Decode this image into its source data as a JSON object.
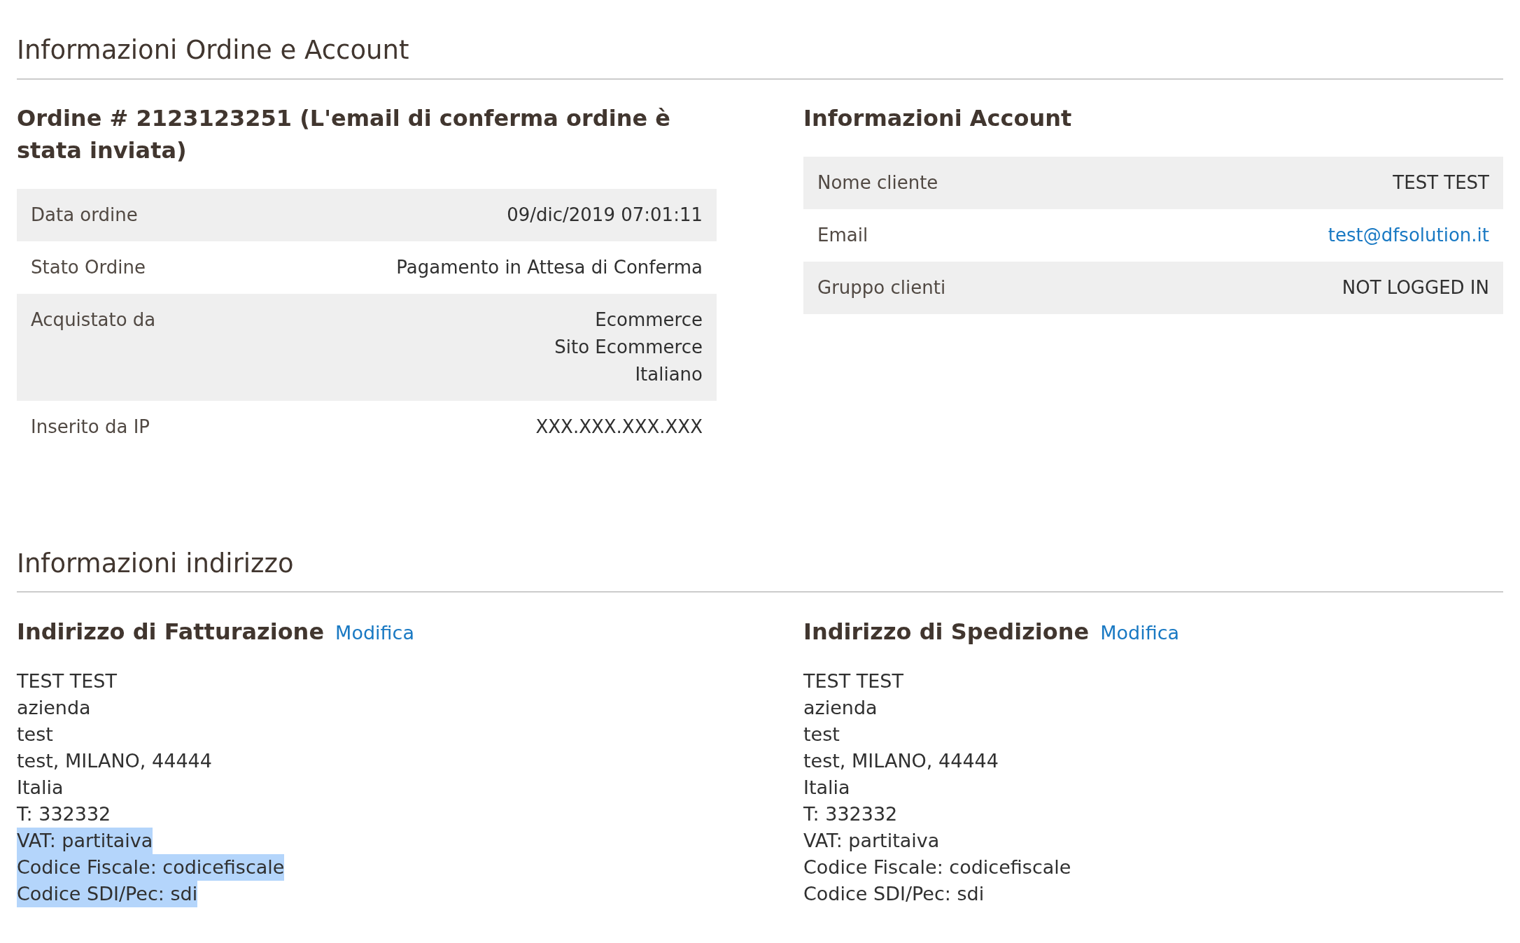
{
  "order_account": {
    "title": "Informazioni Ordine e Account",
    "order": {
      "heading": "Ordine # 2123123251 (L'email di conferma ordine è stata inviata)",
      "rows": [
        {
          "label": "Data ordine",
          "kind": "text",
          "lines": [
            "09/dic/2019 07:01:11"
          ]
        },
        {
          "label": "Stato Ordine",
          "kind": "text",
          "lines": [
            "Pagamento in Attesa di Conferma"
          ]
        },
        {
          "label": "Acquistato da",
          "kind": "text",
          "lines": [
            "Ecommerce",
            "Sito Ecommerce",
            "Italiano"
          ]
        },
        {
          "label": "Inserito da IP",
          "kind": "text",
          "lines": [
            "XXX.XXX.XXX.XXX"
          ]
        }
      ]
    },
    "account": {
      "heading": "Informazioni Account",
      "rows": [
        {
          "label": "Nome cliente",
          "kind": "text",
          "lines": [
            "TEST TEST"
          ]
        },
        {
          "label": "Email",
          "kind": "link",
          "lines": [
            "test@dfsolution.it"
          ]
        },
        {
          "label": "Gruppo clienti",
          "kind": "text",
          "lines": [
            "NOT LOGGED IN"
          ]
        }
      ]
    }
  },
  "address": {
    "title": "Informazioni indirizzo",
    "billing": {
      "heading": "Indirizzo di Fatturazione",
      "edit_link": "Modifica",
      "lines": [
        {
          "text": "TEST TEST",
          "highlighted": false
        },
        {
          "text": "azienda",
          "highlighted": false
        },
        {
          "text": "test",
          "highlighted": false
        },
        {
          "text": "test, MILANO, 44444",
          "highlighted": false
        },
        {
          "text": "Italia",
          "highlighted": false
        },
        {
          "text": "T: 332332",
          "highlighted": false
        },
        {
          "text": "VAT: partitaiva",
          "highlighted": true
        },
        {
          "text": "Codice Fiscale: codicefiscale",
          "highlighted": true
        },
        {
          "text": "Codice SDI/Pec: sdi",
          "highlighted": true
        }
      ]
    },
    "shipping": {
      "heading": "Indirizzo di Spedizione",
      "edit_link": "Modifica",
      "lines": [
        {
          "text": "TEST TEST",
          "highlighted": false
        },
        {
          "text": "azienda",
          "highlighted": false
        },
        {
          "text": "test",
          "highlighted": false
        },
        {
          "text": "test, MILANO, 44444",
          "highlighted": false
        },
        {
          "text": "Italia",
          "highlighted": false
        },
        {
          "text": "T: 332332",
          "highlighted": false
        },
        {
          "text": "VAT: partitaiva",
          "highlighted": false
        },
        {
          "text": "Codice Fiscale: codicefiscale",
          "highlighted": false
        },
        {
          "text": "Codice SDI/Pec: sdi",
          "highlighted": false
        }
      ]
    }
  }
}
